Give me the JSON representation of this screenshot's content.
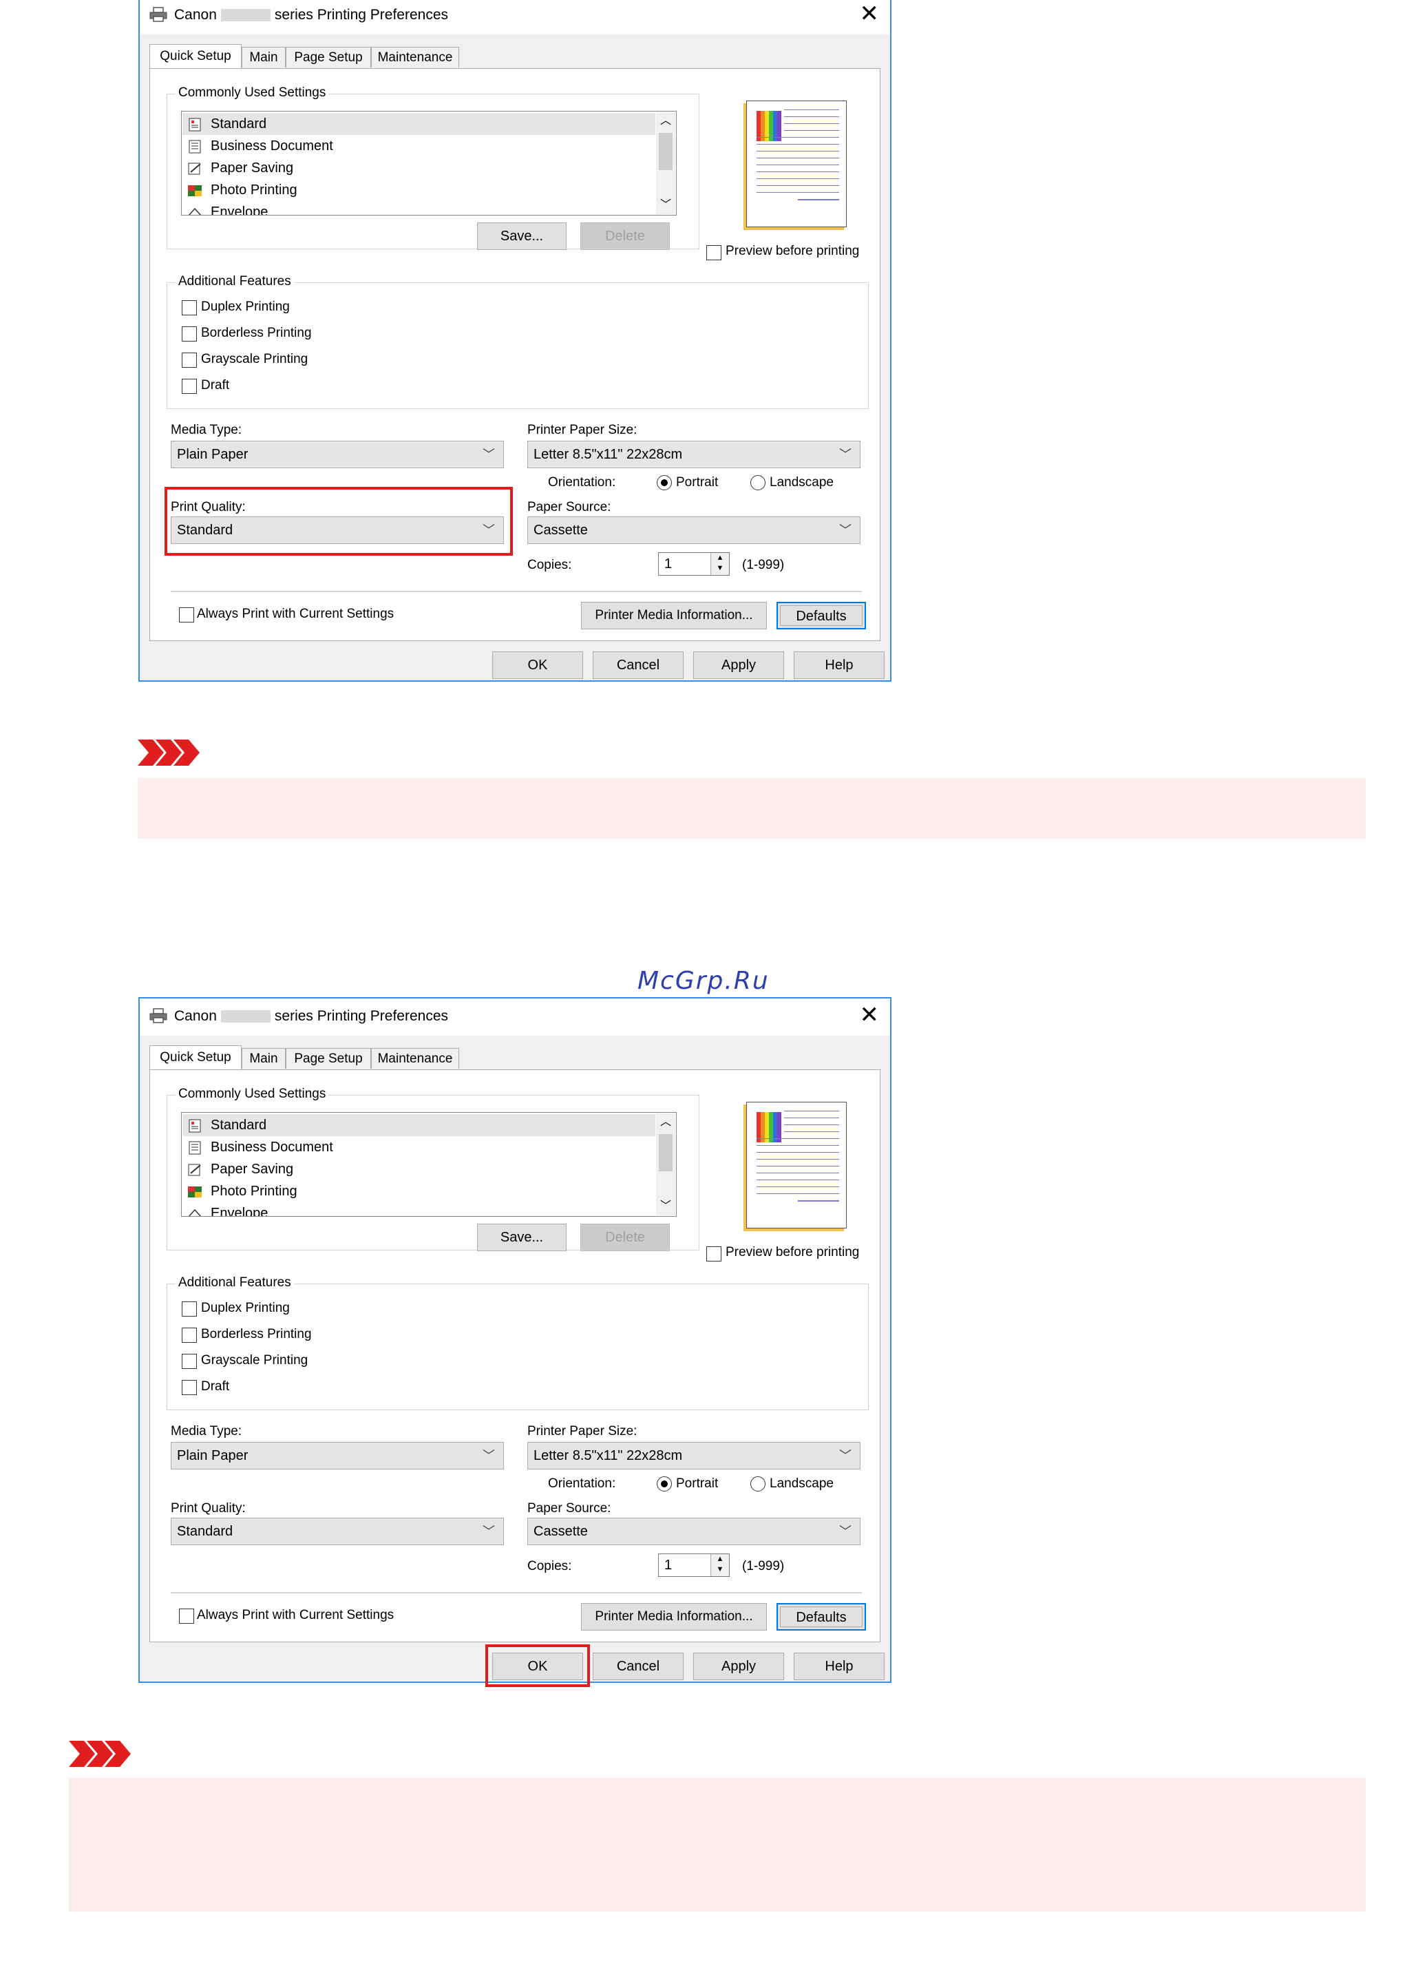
{
  "dialogs": [
    {
      "title_prefix": "Canon",
      "title_suffix": "series Printing Preferences",
      "close_glyph": "✕",
      "tabs": [
        "Quick Setup",
        "Main",
        "Page Setup",
        "Maintenance"
      ],
      "commonly_used_label": "Commonly Used Settings",
      "commonly_used_items": [
        "Standard",
        "Business Document",
        "Paper Saving",
        "Photo Printing",
        "Envelope"
      ],
      "save_button": "Save...",
      "delete_button": "Delete",
      "preview_label": "Preview before printing",
      "additional_features_label": "Additional Features",
      "features": [
        "Duplex Printing",
        "Borderless Printing",
        "Grayscale Printing",
        "Draft"
      ],
      "media_type_label": "Media Type:",
      "media_type_value": "Plain Paper",
      "paper_size_label": "Printer Paper Size:",
      "paper_size_value": "Letter 8.5\"x11\" 22x28cm",
      "orientation_label": "Orientation:",
      "portrait_label": "Portrait",
      "landscape_label": "Landscape",
      "print_quality_label": "Print Quality:",
      "print_quality_value": "Standard",
      "paper_source_label": "Paper Source:",
      "paper_source_value": "Cassette",
      "copies_label": "Copies:",
      "copies_value": "1",
      "copies_range": "(1-999)",
      "always_print_label": "Always Print with Current Settings",
      "printer_media_button": "Printer Media Information...",
      "defaults_button": "Defaults",
      "ok_button": "OK",
      "cancel_button": "Cancel",
      "apply_button": "Apply",
      "help_button": "Help"
    }
  ],
  "watermark": "McGrp.Ru",
  "colors": {
    "highlight": "#e01e1e",
    "note_background": "#fdecec",
    "note_arrow": "#e01e1e",
    "dialog_border": "#3a8ee6"
  }
}
